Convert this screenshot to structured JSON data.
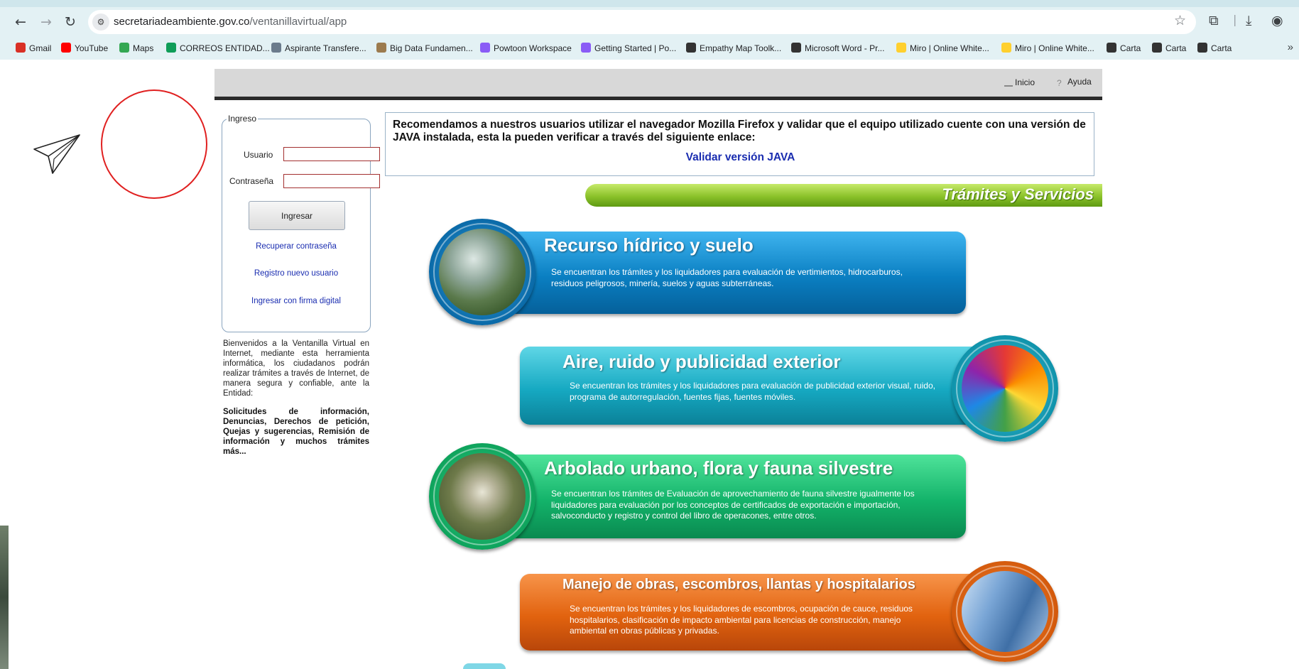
{
  "browser": {
    "url_host": "secretariadeambiente.gov.co",
    "url_path": "/ventanillavirtual/app",
    "bookmarks": [
      {
        "label": "Gmail",
        "color": "#d93025"
      },
      {
        "label": "YouTube",
        "color": "#ff0000"
      },
      {
        "label": "Maps",
        "color": "#34a853"
      },
      {
        "label": "CORREOS ENTIDAD...",
        "color": "#0f9d58"
      },
      {
        "label": "Aspirante Transfere...",
        "color": "#6b7b8c"
      },
      {
        "label": "Big Data Fundamen...",
        "color": "#9c7b4e"
      },
      {
        "label": "Powtoon Workspace",
        "color": "#8a5cf6"
      },
      {
        "label": "Getting Started | Po...",
        "color": "#8a5cf6"
      },
      {
        "label": "Empathy Map Toolk...",
        "color": "#333333"
      },
      {
        "label": "Microsoft Word - Pr...",
        "color": "#333333"
      },
      {
        "label": "Miro | Online White...",
        "color": "#ffd02f"
      },
      {
        "label": "Miro | Online White...",
        "color": "#ffd02f"
      },
      {
        "label": "Carta",
        "color": "#333333"
      },
      {
        "label": "Carta",
        "color": "#333333"
      },
      {
        "label": "Carta",
        "color": "#333333"
      }
    ]
  },
  "header": {
    "inicio": "Inicio",
    "ayuda": "Ayuda"
  },
  "login": {
    "legend": "Ingreso",
    "usuario_label": "Usuario",
    "contrasena_label": "Contraseña",
    "submit_label": "Ingresar",
    "recover_link": "Recuperar contraseña",
    "register_link": "Registro nuevo usuario",
    "digital_sign_link": "Ingresar con firma digital"
  },
  "welcome": {
    "text": "Bienvenidos a la Ventanilla Virtual en Internet, mediante esta herramienta informática, los ciudadanos podrán realizar trámites a través de Internet, de manera segura y confiable, ante la Entidad:",
    "services": "Solicitudes de información, Denuncias, Derechos de petición, Quejas y sugerencias, Remisión de información y muchos trámites más..."
  },
  "notice": {
    "text": "Recomendamos a nuestros usuarios utilizar el navegador Mozilla Firefox y validar que el equipo utilizado cuente con una versión de JAVA instalada, esta la pueden verificar a través del siguiente enlace:",
    "link": "Validar versión JAVA"
  },
  "tramites": {
    "title": "Trámites y Servicios",
    "items": [
      {
        "title": "Recurso hídrico y suelo",
        "desc": "Se encuentran los trámites y los liquidadores para evaluación de vertimientos, hidrocarburos, residuos peligrosos, minería, suelos y aguas subterráneas.",
        "color": "#0e86c8"
      },
      {
        "title": "Aire, ruido y publicidad exterior",
        "desc": "Se encuentran los trámites y los liquidadores para evaluación de publicidad exterior visual, ruido, programa de autorregulación, fuentes fijas, fuentes móviles.",
        "color": "#10a9c0"
      },
      {
        "title": "Arbolado urbano, flora y fauna silvestre",
        "desc": "Se encuentran los trámites de Evaluación de aprovechamiento de fauna silvestre igualmente los liquidadores para evaluación por los conceptos de certificados de exportación e importación, salvoconducto y registro y control del libro de operacones, entre otros.",
        "color": "#15b06a"
      },
      {
        "title": "Manejo de obras, escombros, llantas y hospitalarios",
        "desc": "Se encuentran los trámites y los liquidadores de escombros, ocupación de cauce, residuos hospitalarios, clasificación de impacto ambiental para licencias de construcción, manejo ambiental en obras públicas y privadas.",
        "color": "#e0600e"
      }
    ]
  }
}
